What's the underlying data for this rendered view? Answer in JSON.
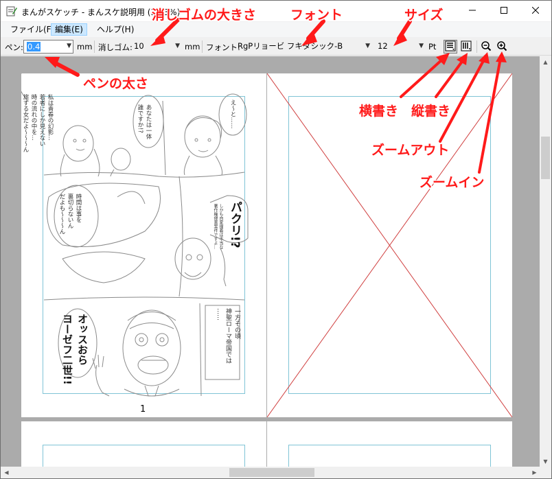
{
  "window": {
    "title": "まんがスケッチ - まんスケ説明用 (33.3%)",
    "minimize_glyph": "—",
    "maximize_glyph": "☐",
    "close_glyph": "✕"
  },
  "menu": {
    "items": [
      {
        "label": "ファイル(F)"
      },
      {
        "label": "編集(E)"
      },
      {
        "label": "ヘルプ(H)"
      }
    ]
  },
  "toolbar": {
    "pen_label": "ペン:",
    "pen_value": "0.4",
    "pen_unit": "mm",
    "eraser_label": "消しゴム:",
    "eraser_value": "10",
    "eraser_unit": "mm",
    "font_label": "フォント:",
    "font_value": "RgPリョービ フキダシック-B",
    "size_value": "12",
    "size_unit": "Pt",
    "icons": [
      "horizontal-text-icon",
      "vertical-text-icon",
      "zoom-out-icon",
      "zoom-in-icon"
    ]
  },
  "canvas": {
    "page_number": "1",
    "speech": {
      "b1": "私は青春の幻影…",
      "b2": "若者にしか見えない",
      "b3": "時の流れの中を…",
      "b4": "旅する女だよ～～～ん",
      "c1": "あなたは一体",
      "c2": "誰ですか!?",
      "d1": "え～と……",
      "e1": "時間は事を",
      "e2": "裏切らないん",
      "e3": "だよも～～～ん",
      "f1": "パクリ!?",
      "g1": "しかも自家撞着は不当な",
      "g2": "著作権侵害案件ですよ…",
      "h1": "オッスおら",
      "h2": "ヨーゼフ二世!!",
      "i1": "一方その頃",
      "i2": "神聖ローマ帝国では",
      "i3": "……"
    }
  },
  "annotations": {
    "eraser_size": "消しゴムの大きさ",
    "font": "フォント",
    "size": "サイズ",
    "pen_width": "ペンの太さ",
    "horizontal": "横書き",
    "vertical": "縦書き",
    "zoom_out": "ズームアウト",
    "zoom_in": "ズームイン"
  },
  "colors": {
    "annotation": "#ff1a1a",
    "guide": "#7fc4d6",
    "selection": "#3399ff",
    "menu_active": "#cce8ff"
  }
}
